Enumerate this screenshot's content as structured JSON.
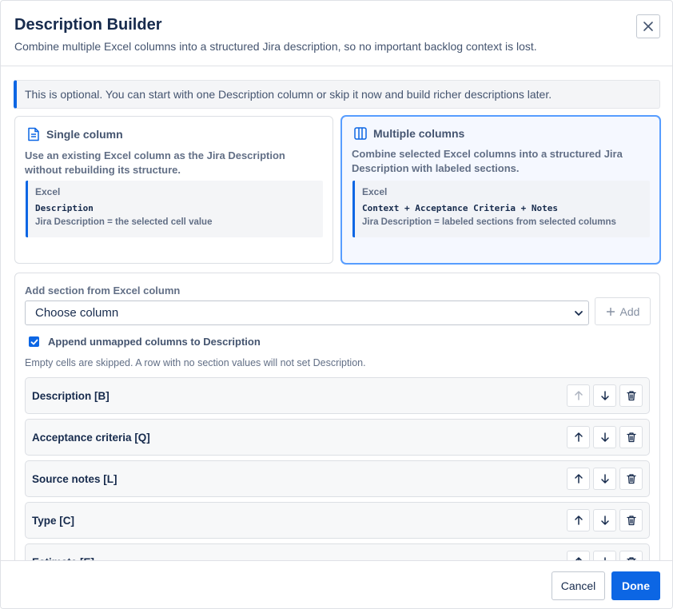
{
  "dialog": {
    "title": "Description Builder",
    "subtitle": "Combine multiple Excel columns into a structured Jira description, so no important backlog context is lost.",
    "close_icon": "close-icon"
  },
  "info": {
    "text": "This is optional. You can start with one Description column or skip it now and build richer descriptions later."
  },
  "modes": [
    {
      "title": "Single column",
      "icon": "document-icon",
      "description": "Use an existing Excel column as the Jira Description without rebuilding its structure.",
      "sample_label": "Excel",
      "sample_code": "Description",
      "sample_result": "Jira Description = the selected cell value",
      "selected": false
    },
    {
      "title": "Multiple columns",
      "icon": "columns-icon",
      "description": "Combine selected Excel columns into a structured Jira Description with labeled sections.",
      "sample_label": "Excel",
      "sample_code": "Context + Acceptance Criteria + Notes",
      "sample_result": "Jira Description = labeled sections from selected columns",
      "selected": true
    }
  ],
  "builder": {
    "add_label": "Add section from Excel column",
    "select_value": "Choose column",
    "add_button": "Add",
    "append_label": "Append unmapped columns to Description",
    "append_checked": true,
    "hint": "Empty cells are skipped. A row with no section values will not set Description.",
    "sections": [
      {
        "label": "Description [B]",
        "up_disabled": true
      },
      {
        "label": "Acceptance criteria [Q]",
        "up_disabled": false
      },
      {
        "label": "Source notes [L]",
        "up_disabled": false
      },
      {
        "label": "Type [C]",
        "up_disabled": false
      },
      {
        "label": "Estimate [E]",
        "up_disabled": false
      }
    ]
  },
  "footer": {
    "cancel": "Cancel",
    "done": "Done"
  },
  "colors": {
    "accent": "#0c66e4",
    "selected_border": "#579dff"
  }
}
